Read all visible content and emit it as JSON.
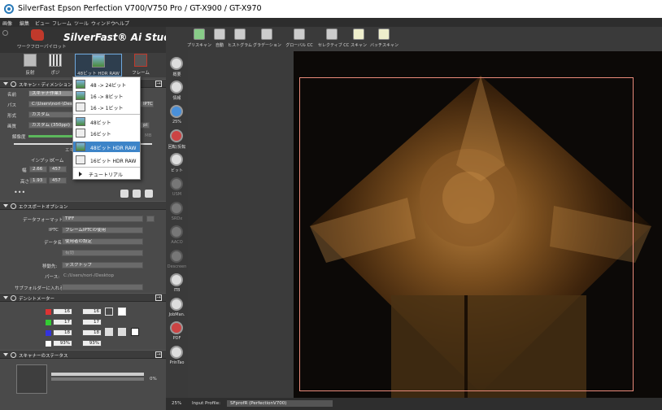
{
  "window": {
    "title": "SilverFast  Epson Perfection V700/V750 Pro / GT-X900 / GT-X970"
  },
  "menu": [
    "画像",
    "編集",
    "ビュー",
    "フレーム",
    "ツール",
    "ウィンドウ",
    "ヘルプ"
  ],
  "brand": {
    "workflow_pilot": "ワークフローパイロット",
    "name": "SilverFast® Ai Studio"
  },
  "modes": [
    {
      "label": "反射",
      "icon": "reflective-icon"
    },
    {
      "label": "ポジ",
      "icon": "positive-film-icon"
    },
    {
      "label": "48ビット HDR RAW",
      "icon": "hdr-raw-icon"
    },
    {
      "label": "フレーム",
      "icon": "frame-tools-icon"
    }
  ],
  "scan_dialog": {
    "header": "スキャン・ディメンション",
    "name_label": "名前",
    "name_value": "スキャナ作業3",
    "path_label": "パス",
    "path_value": "C:\\Users\\nori-\\Desk",
    "path_extra": "IPTC",
    "format_label": "形式",
    "format_value": "カスタム",
    "screen_label": "画質",
    "screen_value": "カスタム (350ppi)",
    "screen_extra": "pi",
    "resolution_label": "解像度",
    "resolution_extra": "MB",
    "input_label": "インプット",
    "zoom_label": "ズーム",
    "width_label": "幅",
    "width_value": "2.66",
    "width_zoom": "457",
    "height_label": "高さ",
    "height_value": "1.93",
    "height_zoom": "457",
    "partial_label": "エキ"
  },
  "bitdepth_dropdown": {
    "items": [
      {
        "label": "48 -> 24ビット",
        "selected": false
      },
      {
        "label": "16 -> 8ビット",
        "selected": false
      },
      {
        "label": "16 -> 1ビット",
        "selected": false
      },
      {
        "label": "48ビット",
        "selected": false
      },
      {
        "label": "16ビット",
        "selected": false
      },
      {
        "label": "48ビット HDR RAW",
        "selected": true
      },
      {
        "label": "16ビット HDR RAW",
        "selected": false
      }
    ],
    "tutorial": "チュートリアル"
  },
  "export": {
    "header": "エクスポートオプション",
    "format_label": "データフォーマット:",
    "format_value": "TIFF",
    "iptc_label": "IPTC",
    "iptc_value": "フレームIPTCの使用",
    "dataname_label": "データ名",
    "dataname_value": "使用者の設定",
    "extra_value": "有効",
    "dest_label": "移動先:",
    "dest_value": "デスクトップ",
    "path_label": "パース:",
    "path_value": "C:/Users/nori-/Desktop",
    "subfolder_label": "サブフォルダーに入れる:"
  },
  "densitometer": {
    "header": "デンシトメーター",
    "rows": [
      {
        "a": "16",
        "b": "16"
      },
      {
        "a": "17",
        "b": "17"
      },
      {
        "a": "18",
        "b": "18"
      },
      {
        "a": "93%",
        "b": "93%"
      }
    ]
  },
  "scanner_status": {
    "header": "スキャナーのステータス",
    "progress": "0%",
    "progress_fraction": 0
  },
  "tools": [
    {
      "label": "概要",
      "icon": "overview-icon"
    },
    {
      "label": "情報",
      "icon": "info-icon"
    },
    {
      "label": "25%",
      "icon": "zoom-icon"
    },
    {
      "label": "回転/反転",
      "icon": "rotate-flip-icon"
    },
    {
      "label": "ビット",
      "icon": "bitdepth-icon"
    },
    {
      "label": "USM",
      "icon": "usm-icon"
    },
    {
      "label": "SRDx",
      "icon": "srdx-icon"
    },
    {
      "label": "AACO",
      "icon": "aaco-icon"
    },
    {
      "label": "Descreen",
      "icon": "descreen-icon"
    },
    {
      "label": "ITB",
      "icon": "itb-icon"
    },
    {
      "label": "JobMan.",
      "icon": "jobmanager-icon"
    },
    {
      "label": "PDF",
      "icon": "pdf-icon"
    },
    {
      "label": "PrinTao",
      "icon": "printao-icon"
    }
  ],
  "topbar": [
    {
      "label": "プリスキャン",
      "icon": "prescan-icon"
    },
    {
      "label": "自動",
      "icon": "auto-icon"
    },
    {
      "label": "ヒストグラム",
      "icon": "histogram-icon"
    },
    {
      "label": "グラデーション",
      "icon": "gradation-icon"
    },
    {
      "label": "グローバル CC",
      "icon": "global-cc-icon"
    },
    {
      "label": "セレクティブ CC",
      "icon": "selective-cc-icon"
    },
    {
      "label": "スキャン",
      "icon": "scan-icon"
    },
    {
      "label": "バッチスキャン",
      "icon": "batch-scan-icon"
    }
  ],
  "status": {
    "zoom": "25%",
    "input_profile_label": "Input Profile:",
    "input_profile_value": "SFprofR (PerfectionV700)"
  },
  "colors": {
    "accent": "#3d84c8",
    "selection": "#e98a7a",
    "panel": "#4a4a4a"
  }
}
